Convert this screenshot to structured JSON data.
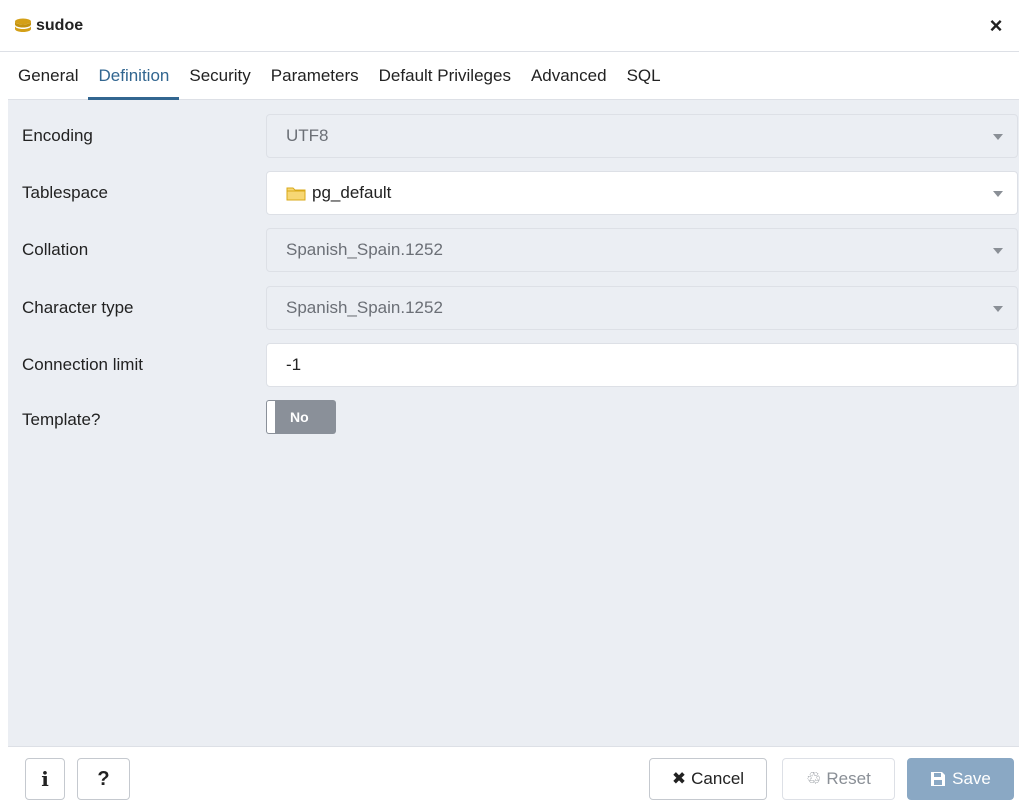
{
  "dialog": {
    "title": "sudoe",
    "title_icon": "database-icon",
    "close_icon": "close-icon",
    "close_glyph": "×"
  },
  "tabs": [
    {
      "label": "General",
      "active": false
    },
    {
      "label": "Definition",
      "active": true
    },
    {
      "label": "Security",
      "active": false
    },
    {
      "label": "Parameters",
      "active": false
    },
    {
      "label": "Default Privileges",
      "active": false
    },
    {
      "label": "Advanced",
      "active": false
    },
    {
      "label": "SQL",
      "active": false
    }
  ],
  "form": {
    "encoding": {
      "label": "Encoding",
      "value": "UTF8",
      "disabled": true
    },
    "tablespace": {
      "label": "Tablespace",
      "value": "pg_default",
      "icon": "folder-icon",
      "disabled": false
    },
    "collation": {
      "label": "Collation",
      "value": "Spanish_Spain.1252",
      "disabled": true
    },
    "character_type": {
      "label": "Character type",
      "value": "Spanish_Spain.1252",
      "disabled": true
    },
    "connection_limit": {
      "label": "Connection limit",
      "value": "-1"
    },
    "template": {
      "label": "Template?",
      "value": "No",
      "checked": false
    }
  },
  "footer": {
    "info_label": "i",
    "help_label": "?",
    "cancel_label": "Cancel",
    "cancel_glyph": "✖",
    "reset_label": "Reset",
    "reset_glyph": "♲",
    "save_label": "Save"
  },
  "colors": {
    "accent": "#326690",
    "form_bg": "#ebeef3",
    "toggle_off": "#8a9099",
    "save_bg": "#8aa8c4"
  }
}
